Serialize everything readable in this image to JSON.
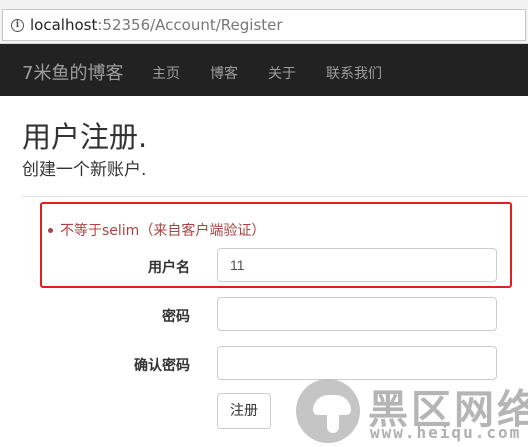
{
  "browser": {
    "url_host": "localhost",
    "url_rest": ":52356/Account/Register"
  },
  "navbar": {
    "brand": "7米鱼的博客",
    "items": [
      "主页",
      "博客",
      "关于",
      "联系我们"
    ]
  },
  "page": {
    "title": "用户注册.",
    "subtitle": "创建一个新账户."
  },
  "form": {
    "error": "不等于selim（来自客户端验证）",
    "username": {
      "label": "用户名",
      "value": "11"
    },
    "password": {
      "label": "密码",
      "value": ""
    },
    "confirm_password": {
      "label": "确认密码",
      "value": ""
    },
    "submit_label": "注册"
  },
  "watermark": {
    "title": "黑区网络",
    "url": "www.heiqu.com"
  },
  "colors": {
    "navbar_bg": "#222222",
    "nav_text": "#9d9d9d",
    "error_text": "#a94442",
    "highlight_border": "#e0201f"
  }
}
